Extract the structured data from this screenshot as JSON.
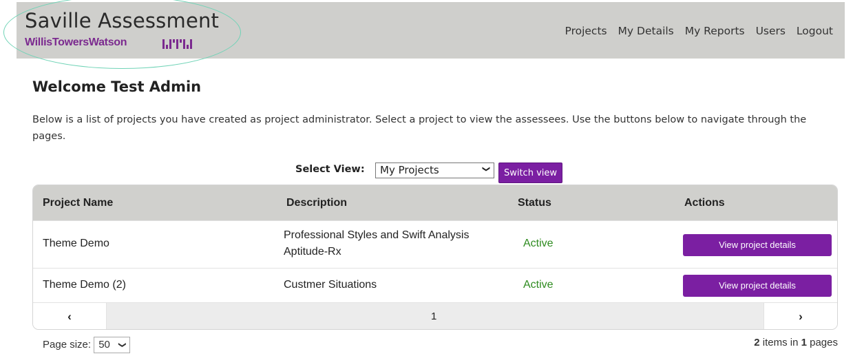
{
  "brand": {
    "title": "Saville Assessment",
    "subtitle": "WillisTowersWatson",
    "logo_mark": "wtw-logo-mark",
    "accent_color": "#7b1fa2"
  },
  "nav": {
    "items": [
      "Projects",
      "My Details",
      "My Reports",
      "Users",
      "Logout"
    ]
  },
  "welcome": "Welcome Test Admin",
  "intro": "Below is a list of projects you have created as project administrator. Select a project to view the assessees. Use the buttons below to navigate through the pages.",
  "view": {
    "label": "Select View:",
    "selected": "My Projects",
    "switch_label": "Switch view"
  },
  "table": {
    "columns": [
      "Project Name",
      "Description",
      "Status",
      "Actions"
    ],
    "rows": [
      {
        "name": "Theme Demo",
        "description_line1": "Professional Styles and Swift Analysis",
        "description_line2": "Aptitude-Rx",
        "status": "Active",
        "action": "View project details"
      },
      {
        "name": "Theme Demo (2)",
        "description_line1": "Custmer Situations",
        "description_line2": "",
        "status": "Active",
        "action": "View project details"
      }
    ],
    "status_color": "#2e8b1f"
  },
  "pager": {
    "prev": "‹",
    "current_page": "1",
    "next": "›"
  },
  "page_size": {
    "label": "Page size:",
    "value": "50"
  },
  "items_info": {
    "count": "2",
    "text1": " items in ",
    "pages": "1",
    "text2": " pages"
  }
}
